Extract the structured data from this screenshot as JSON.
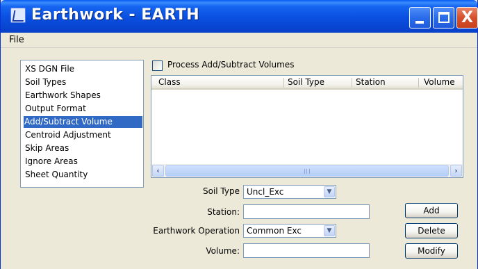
{
  "window": {
    "title": "Earthwork - EARTH",
    "controls": {
      "minimize": "minimize",
      "maximize": "maximize",
      "close": "X"
    }
  },
  "menu": {
    "file": "File"
  },
  "sidebar": {
    "items": [
      {
        "label": "XS DGN File",
        "selected": false
      },
      {
        "label": "Soil Types",
        "selected": false
      },
      {
        "label": "Earthwork Shapes",
        "selected": false
      },
      {
        "label": "Output Format",
        "selected": false
      },
      {
        "label": "Add/Subtract Volume",
        "selected": true
      },
      {
        "label": "Centroid Adjustment",
        "selected": false
      },
      {
        "label": "Skip Areas",
        "selected": false
      },
      {
        "label": "Ignore Areas",
        "selected": false
      },
      {
        "label": "Sheet Quantity",
        "selected": false
      }
    ]
  },
  "process_checkbox": {
    "label": "Process Add/Subtract Volumes",
    "checked": false
  },
  "grid": {
    "columns": [
      "Class",
      "Soil Type",
      "Station",
      "Volume"
    ],
    "rows": []
  },
  "form": {
    "soil_type": {
      "label": "Soil Type",
      "value": "Uncl_Exc"
    },
    "station": {
      "label": "Station:",
      "value": ""
    },
    "earthwork_operation": {
      "label": "Earthwork Operation",
      "value": "Common Exc"
    },
    "volume": {
      "label": "Volume:",
      "value": ""
    }
  },
  "buttons": {
    "add": "Add",
    "delete": "Delete",
    "modify": "Modify"
  },
  "icons": {
    "app": "earthwork-app-icon",
    "dropdown": "chevron-down-icon",
    "scroll_left": "arrow-left-icon",
    "scroll_right": "arrow-right-icon"
  },
  "colors": {
    "title_bar": "#0a4fe0",
    "selection": "#316ac5",
    "close_button": "#d6502b",
    "dialog_bg": "#ece9d8"
  }
}
